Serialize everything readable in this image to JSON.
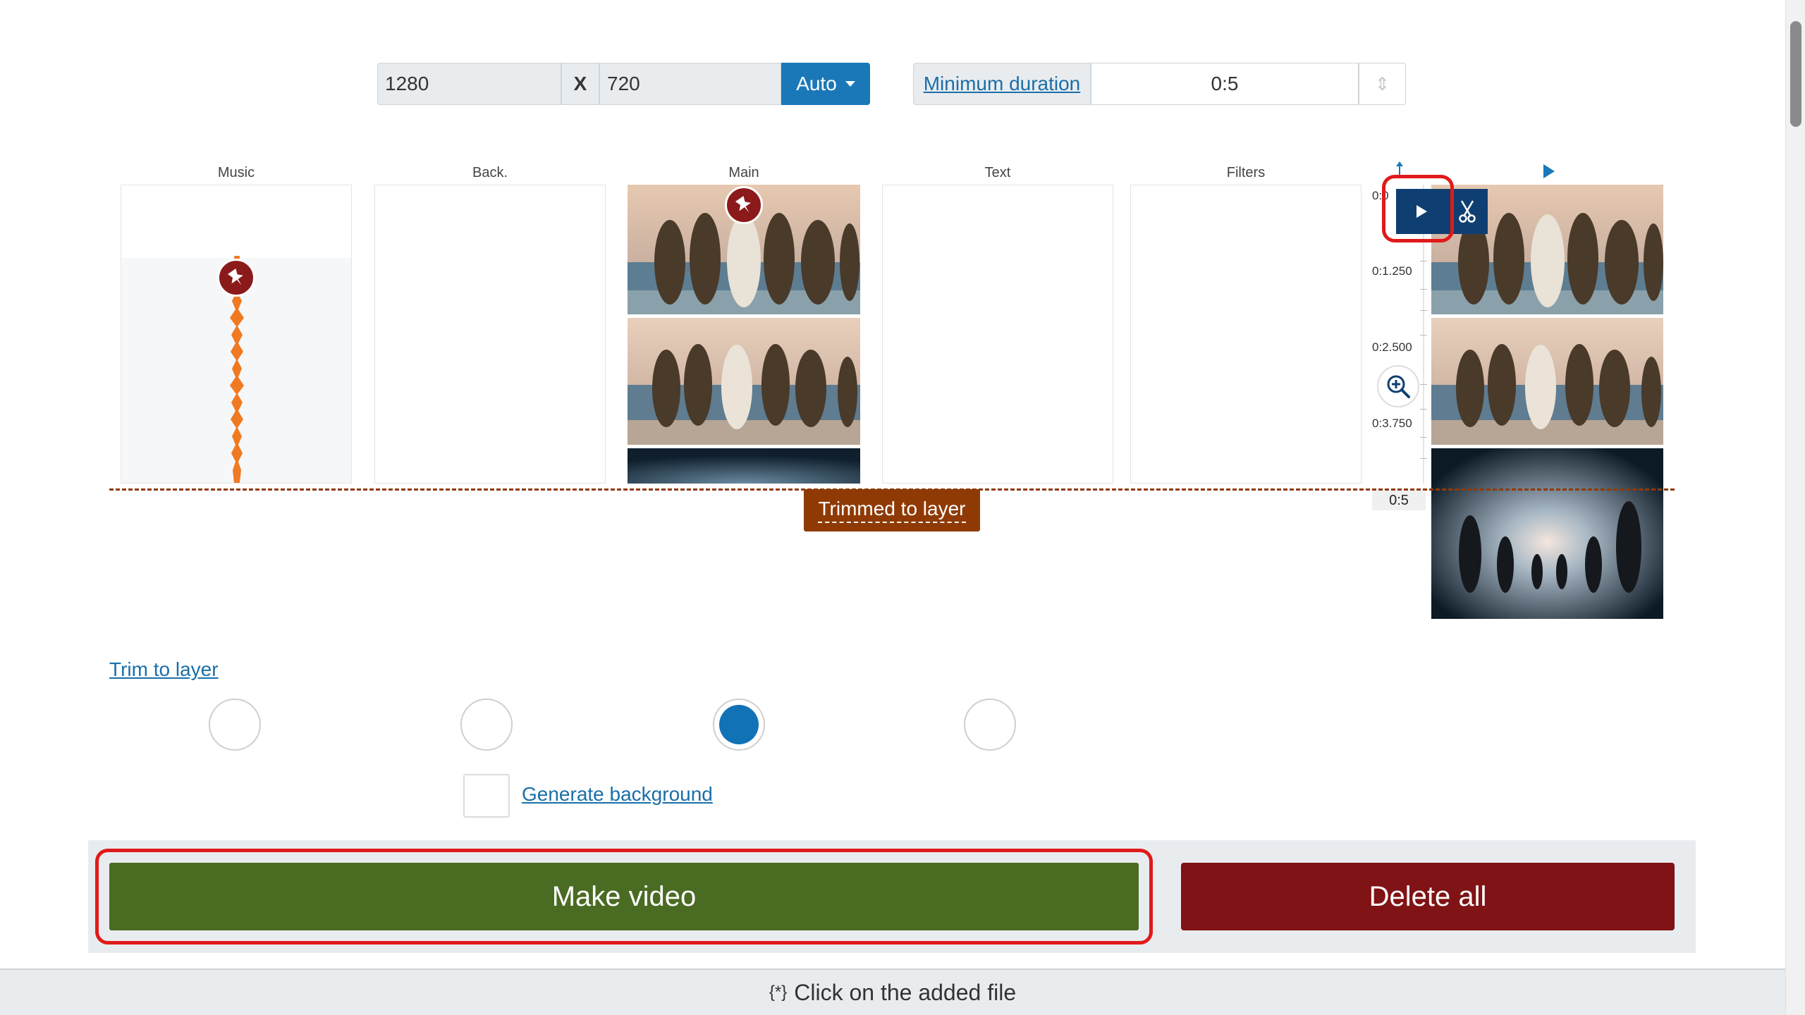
{
  "resolution": {
    "width": "1280",
    "separator": "X",
    "height": "720",
    "mode_label": "Auto"
  },
  "min_duration": {
    "label": "Minimum duration",
    "value": "0:5"
  },
  "columns": [
    "Music",
    "Back.",
    "Main",
    "Text",
    "Filters"
  ],
  "timeline": {
    "start_label": "0:0",
    "times": [
      "0:1.250",
      "0:2.500",
      "0:3.750"
    ],
    "end_label": "0:5",
    "trim_badge": "Trimmed to layer"
  },
  "trim_link": "Trim to layer",
  "generate_background": "Generate background",
  "buttons": {
    "make_video": "Make video",
    "delete_all": "Delete all"
  },
  "footer": {
    "icon_glyph": "{*}",
    "text": "Click on the added file"
  },
  "colors": {
    "accent_blue": "#1a78b8",
    "make_green": "#4a6b22",
    "delete_red": "#7f1315",
    "trim_brown": "#8f3a05",
    "waveform_orange": "#f07a22",
    "highlight_red": "#e01a1a"
  }
}
